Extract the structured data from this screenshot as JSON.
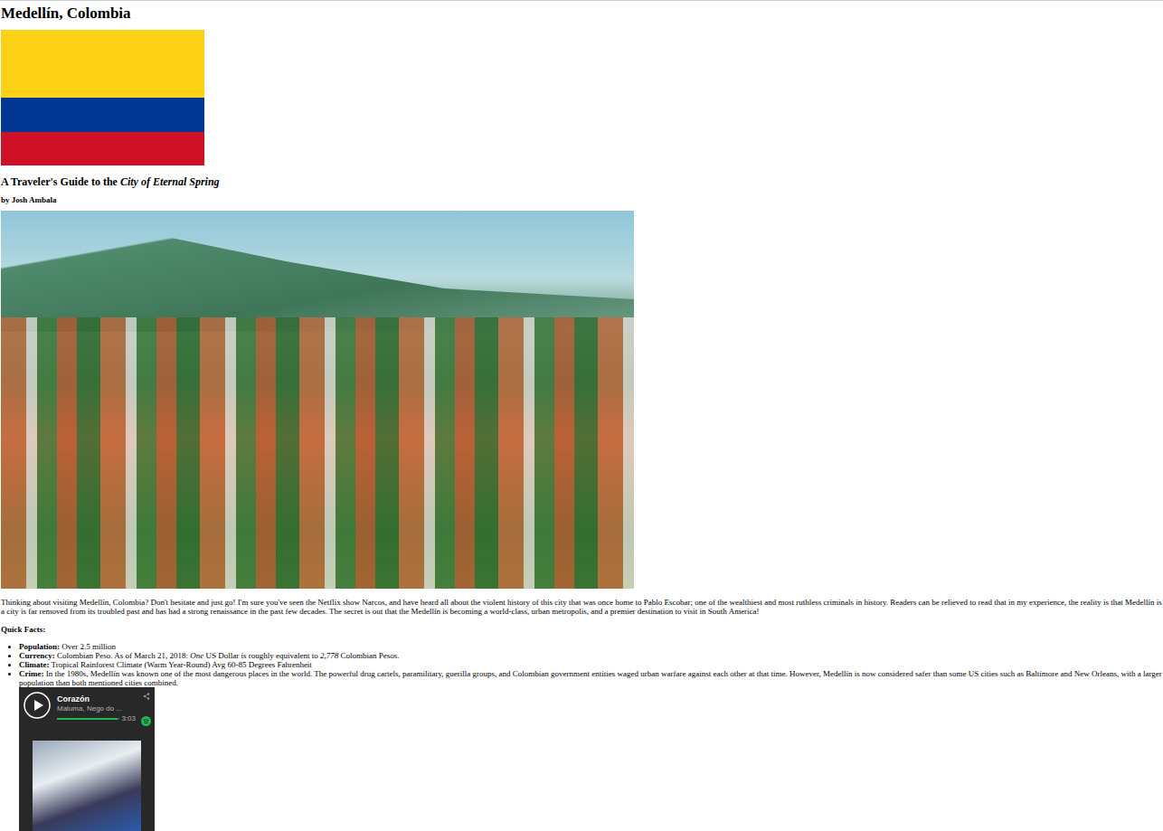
{
  "page": {
    "title": "Medellín, Colombia",
    "subtitle": [
      {
        "text": "A Traveler's Guide to the ",
        "italic": false
      },
      {
        "text": "City of Eternal Spring",
        "italic": true
      }
    ],
    "byline": "by Josh Ambala",
    "intro": "Thinking about visiting Medellín, Colombia? Don't hesitate and just go! I'm sure you've seen the Netflix show Narcos, and have heard all about the violent history of this city that was once home to Pablo Escobar; one of the wealthiest and most ruthless criminals in history. Readers can be relieved to read that in my experience, the reality is that Medellín is a city is far removed from its troubled past and has had a strong renaissance in the past few decades. The secret is out that the Medellín is becoming a world-class, urban metropolis, and a premier destination to visit in South America!",
    "facts_heading": "Quick Facts:",
    "facts": [
      {
        "label": "Population:",
        "parts": [
          {
            "text": " Over 2.5 million",
            "italic": false
          }
        ]
      },
      {
        "label": "Currency:",
        "parts": [
          {
            "text": " Colombian Peso. As of March 21, 2018: ",
            "italic": false
          },
          {
            "text": "One",
            "italic": true
          },
          {
            "text": " US Dollar is roughly equivalent to ",
            "italic": false
          },
          {
            "text": "2,778",
            "italic": true
          },
          {
            "text": " Colombian Pesos.",
            "italic": false
          }
        ]
      },
      {
        "label": "Climate:",
        "parts": [
          {
            "text": " Tropical Rainforest Climate (Warm Year-Round) Avg 60-85 Degrees Fahrenheit",
            "italic": false
          }
        ]
      },
      {
        "label": "Crime:",
        "parts": [
          {
            "text": " In the 1980s, Medellín was known one of the most dangerous places in the world. The powerful drug cartels, paramilitary, guerilla groups, and Colombian government entities waged urban warfare against each other at that time. However, Medellín is now considered safer than some US cities such as Baltimore and New Orleans, with a larger population than both mentioned cities combined.",
            "italic": false
          }
        ]
      }
    ]
  },
  "player": {
    "track": "Corazón",
    "artist": "Maluma, Nego do ...",
    "time": "3:03",
    "level": 0.97,
    "playing": false
  }
}
